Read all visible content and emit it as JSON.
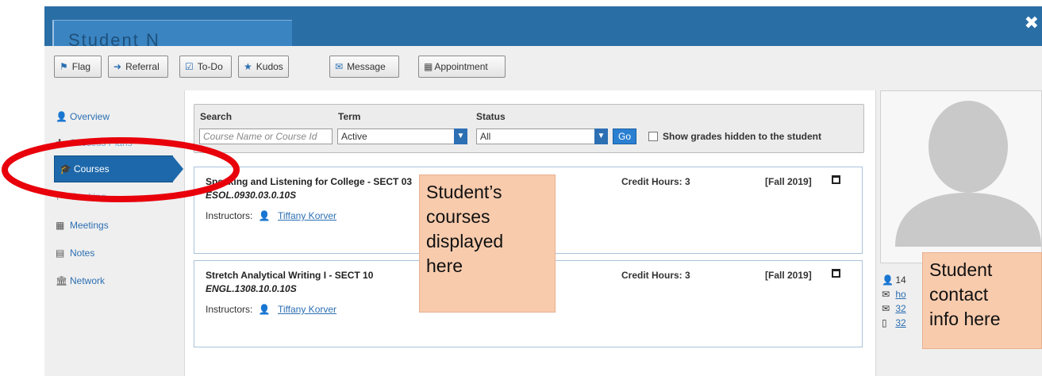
{
  "header": {
    "student_name_redacted": "Student N",
    "close_label": "✖"
  },
  "toolbar": {
    "flag": "Flag",
    "referral": "Referral",
    "todo": "To-Do",
    "kudos": "Kudos",
    "message": "Message",
    "appointment": "Appointment"
  },
  "nav": {
    "overview": "Overview",
    "success_plans": "Success Plans",
    "courses": "Courses",
    "tracking": "Tracking",
    "meetings": "Meetings",
    "notes": "Notes",
    "network": "Network"
  },
  "filter": {
    "search_label": "Search",
    "search_placeholder": "Course Name or Course Id",
    "term_label": "Term",
    "term_value": "Active",
    "status_label": "Status",
    "status_value": "All",
    "go_label": "Go",
    "hidden_grades_label": "Show grades hidden to the student"
  },
  "courses": [
    {
      "title": "Speaking and Listening for College - SECT 03",
      "code": "ESOL.0930.03.0.10S",
      "instructors_label": "Instructors:",
      "instructor": "Tiffany Korver",
      "credit_hours": "Credit Hours: 3",
      "term": "[Fall 2019]"
    },
    {
      "title": "Stretch Analytical Writing I - SECT 10",
      "code": "ENGL.1308.10.0.10S",
      "instructors_label": "Instructors:",
      "instructor": "Tiffany Korver",
      "credit_hours": "Credit Hours: 3",
      "term": "[Fall 2019]"
    }
  ],
  "contact": {
    "row1": "14",
    "row2": "ho",
    "row3": "32",
    "row4": "32"
  },
  "annotations": {
    "courses_callout": [
      "Student’s",
      "courses",
      "displayed",
      "here"
    ],
    "contact_callout": [
      "Student",
      "contact",
      "info here"
    ]
  },
  "colors": {
    "header_blue": "#2a6ea6",
    "active_nav": "#1d68aa",
    "link_blue": "#2c6fb3",
    "callout_fill": "#f8cbad",
    "oval_red": "#e8000b"
  }
}
